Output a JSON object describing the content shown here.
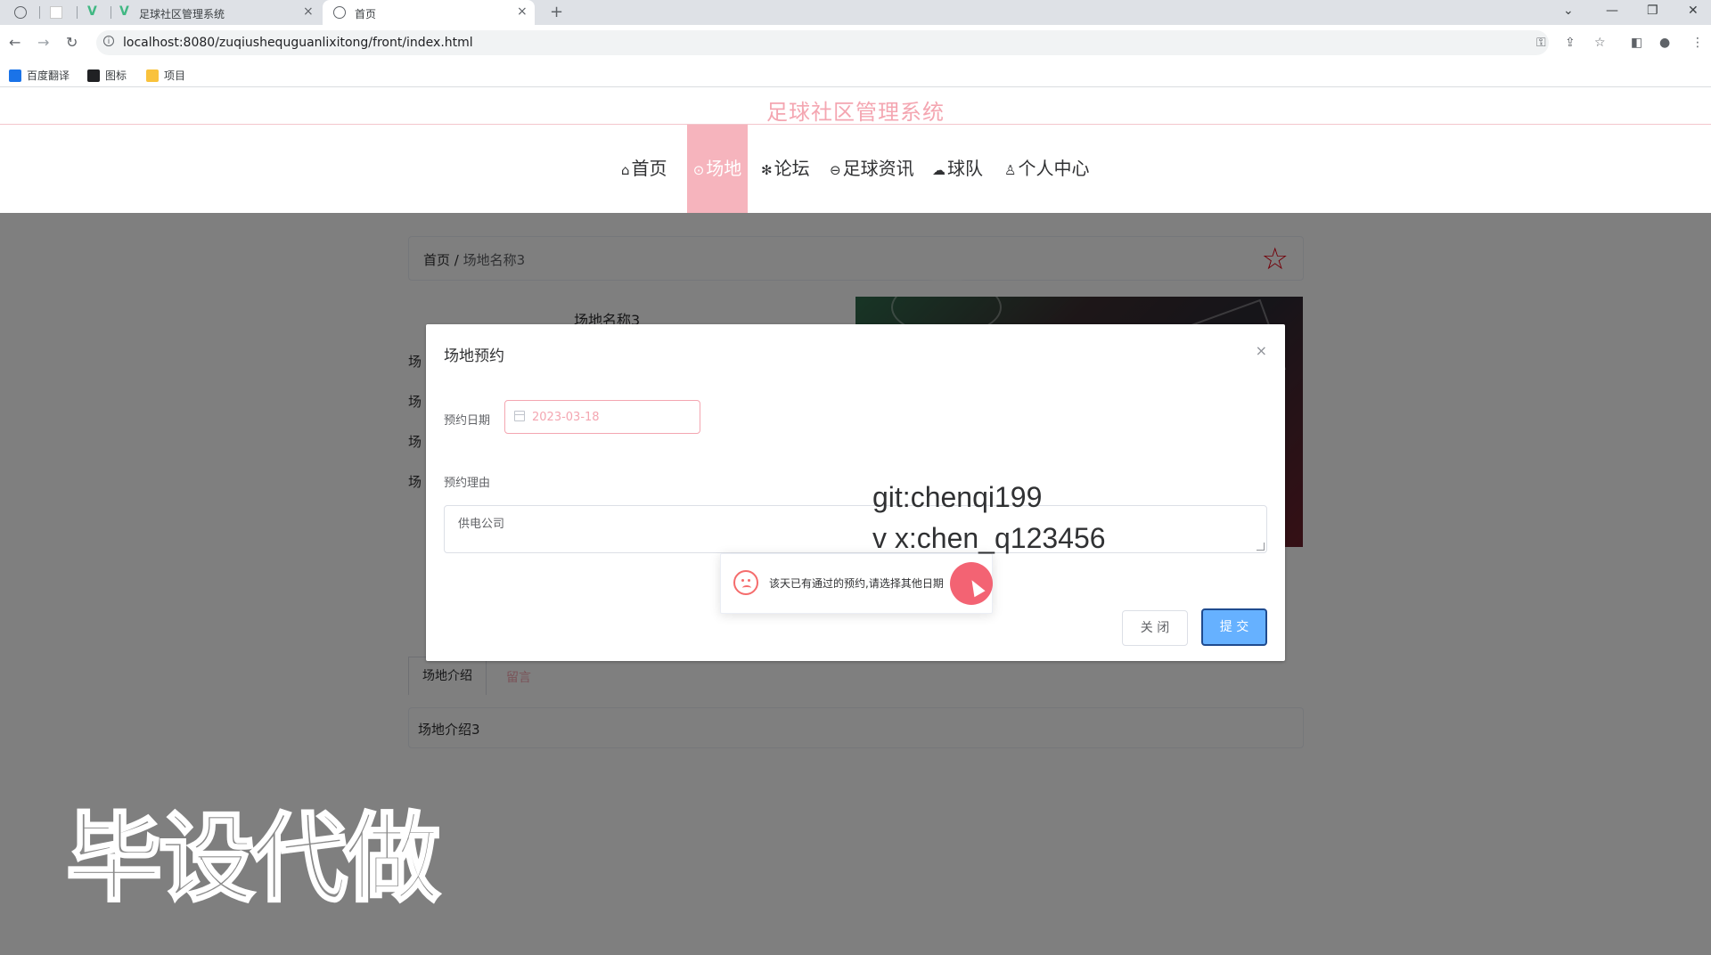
{
  "browser": {
    "tabs": [
      {
        "label": ""
      },
      {
        "label": ""
      },
      {
        "label": ""
      },
      {
        "label": "足球社区管理系统"
      },
      {
        "label": "首页"
      }
    ],
    "new_tab": "+",
    "url": "localhost:8080/zuqiushequguanlixitong/front/index.html",
    "bookmarks": [
      {
        "label": "百度翻译",
        "color": "#1a73e8"
      },
      {
        "label": "图标",
        "color": "#202124"
      },
      {
        "label": "项目",
        "color": "#f9c23c"
      }
    ]
  },
  "site": {
    "title": "足球社区管理系统",
    "accent_color": "#f6b4bd",
    "nav": [
      {
        "label": "首页",
        "icon": "home-icon",
        "glyph": "⌂"
      },
      {
        "label": "场地",
        "icon": "location-icon",
        "glyph": "⊙"
      },
      {
        "label": "论坛",
        "icon": "snowflake-icon",
        "glyph": "✻"
      },
      {
        "label": "足球资讯",
        "icon": "news-icon",
        "glyph": "⊖"
      },
      {
        "label": "球队",
        "icon": "cloud-icon",
        "glyph": "☁"
      },
      {
        "label": "个人中心",
        "icon": "user-icon",
        "glyph": "♙"
      }
    ],
    "active_nav": "场地"
  },
  "page": {
    "breadcrumb_home": "首页",
    "breadcrumb_sep": " / ",
    "breadcrumb_current": "场地名称3",
    "venue_name": "场地名称3",
    "venue_rows": [
      "场",
      "场",
      "场",
      "场"
    ],
    "tab_intro": "场地介绍",
    "tab_message": "留言",
    "intro_content": "场地介绍3"
  },
  "dialog": {
    "title": "场地预约",
    "close_glyph": "×",
    "date_label": "预约日期",
    "date_value": "2023-03-18",
    "reason_label": "预约理由",
    "reason_value": "供电公司",
    "close_button": "关 闭",
    "submit_button": "提 交"
  },
  "toast": {
    "message": "该天已有通过的预约,请选择其他日期",
    "icon": "sad-face-icon"
  },
  "watermark": {
    "git": "git:chenqi199",
    "vx": "v x:chen_q123456",
    "big": "毕设代做"
  }
}
